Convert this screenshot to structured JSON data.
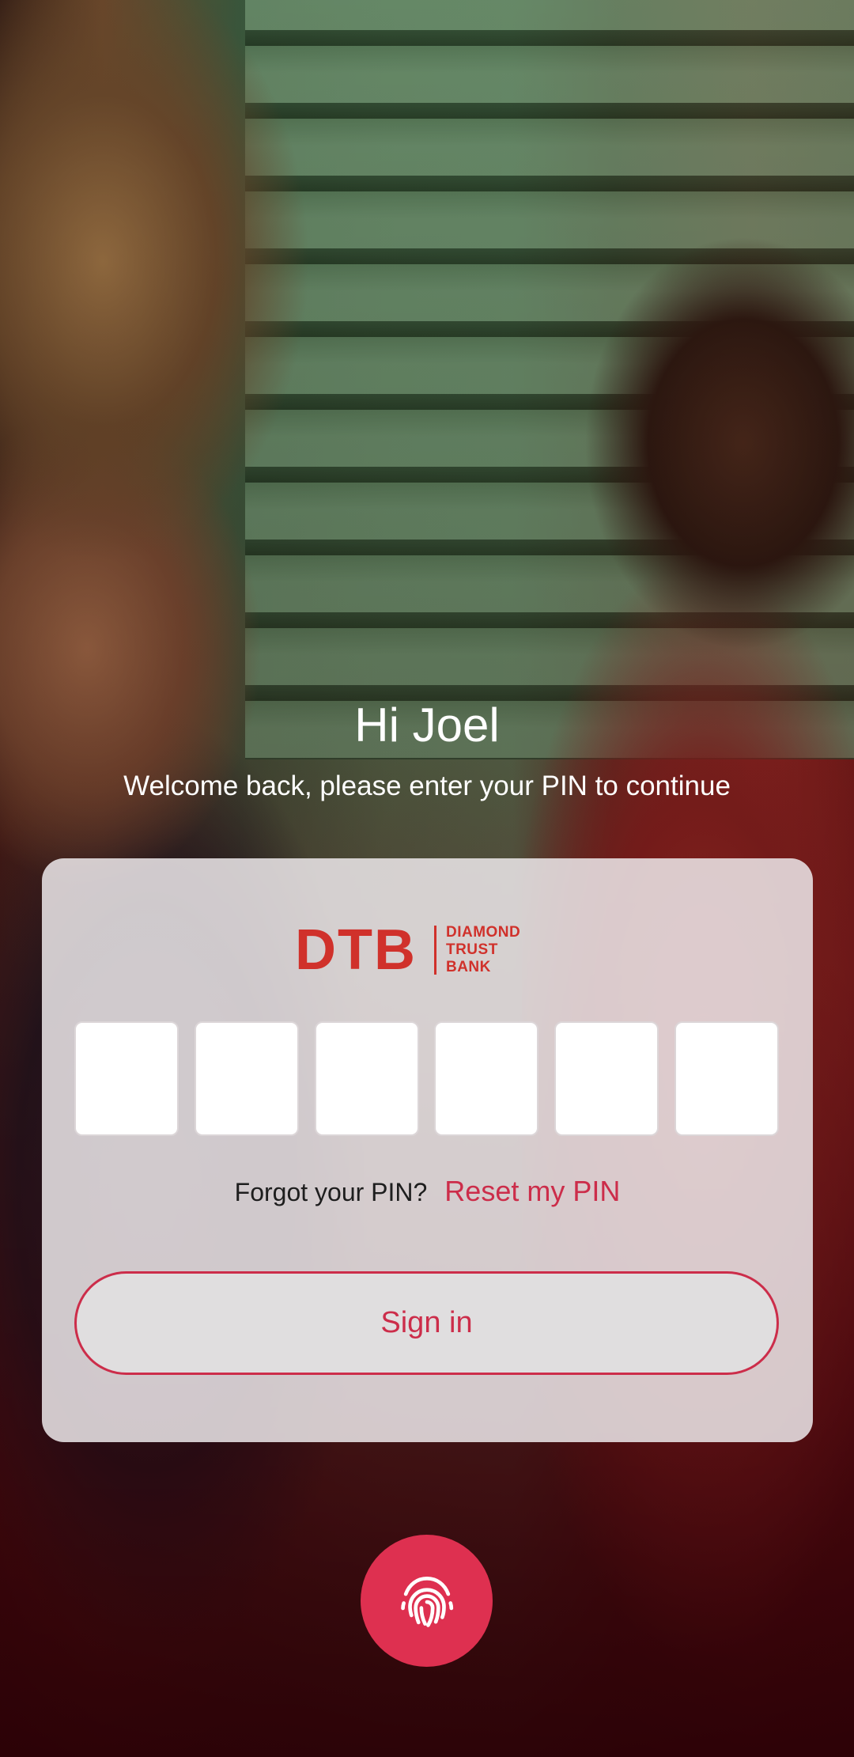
{
  "greeting": "Hi Joel",
  "subtitle": "Welcome back, please enter your PIN to continue",
  "logo": {
    "mark": "DTB",
    "line1": "DIAMOND",
    "line2": "TRUST",
    "line3": "BANK"
  },
  "pin": {
    "length": 6
  },
  "forgot": {
    "text": "Forgot your PIN?",
    "link": "Reset my PIN"
  },
  "signin": {
    "label": "Sign in"
  },
  "biometric": {
    "icon": "fingerprint-icon"
  },
  "colors": {
    "brand_red": "#d0312b",
    "accent": "#cc2d4a",
    "fab": "#de3050"
  }
}
